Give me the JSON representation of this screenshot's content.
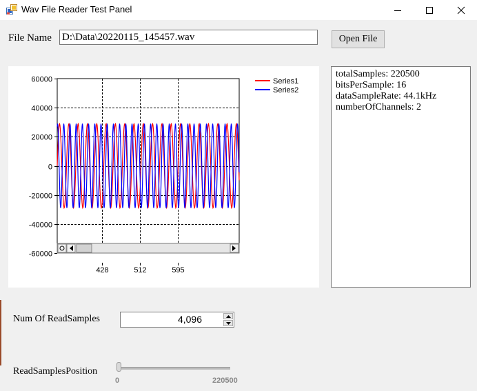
{
  "window": {
    "title": "Wav File Reader Test Panel",
    "icon": "app-window-icon",
    "controls": [
      "minimize-icon",
      "maximize-icon",
      "close-icon"
    ]
  },
  "file": {
    "label": "File Name",
    "path": "D:\\Data\\20220115_145457.wav",
    "open_button": "Open File"
  },
  "info": {
    "lines": [
      "totalSamples: 220500",
      "bitsPerSample: 16",
      "dataSampleRate: 44.1kHz",
      "numberOfChannels: 2"
    ]
  },
  "num_samples": {
    "label": "Num Of ReadSamples",
    "value": "4,096"
  },
  "position": {
    "label": "ReadSamplesPosition",
    "min_label": "0",
    "max_label": "220500",
    "value": 0
  },
  "chart_data": {
    "type": "line",
    "ylim": [
      -60000,
      60000
    ],
    "yticks": [
      "60000",
      "40000",
      "20000",
      "0",
      "-20000",
      "-40000",
      "-60000"
    ],
    "ytick_values": [
      60000,
      40000,
      20000,
      0,
      -20000,
      -40000,
      -60000
    ],
    "xlim": [
      330,
      730
    ],
    "xticks": [
      "428",
      "512",
      "595"
    ],
    "xtick_values": [
      428,
      512,
      595
    ],
    "grid": true,
    "legend_position": "top-right",
    "series": [
      {
        "name": "Series1",
        "color": "#ff0000",
        "amplitude": 29000,
        "period": 13.5,
        "phase": 0.0
      },
      {
        "name": "Series2",
        "color": "#0000ff",
        "amplitude": 29000,
        "period": 9.0,
        "phase": 1.2
      }
    ]
  }
}
